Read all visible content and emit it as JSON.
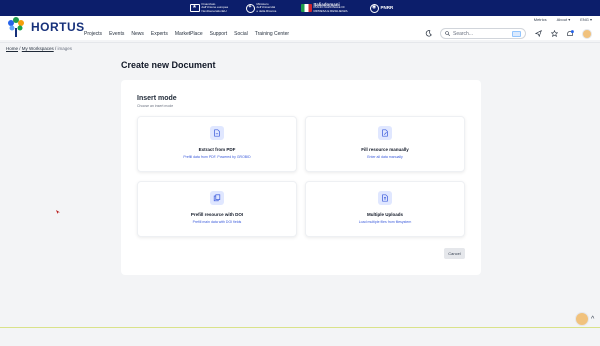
{
  "funding": {
    "eu_line1": "Finanziato",
    "eu_line2": "dall'Unione europea",
    "eu_line3": "NextGenerationEU",
    "ministero_line1": "Ministero",
    "ministero_line2": "dell'Università",
    "ministero_line3": "e della Ricerca",
    "italiadomani": "Italiadomani",
    "italiadomani_sub": "PIANO NAZIONALE DI RIPRESA E RESILIENZA",
    "pnrr": "PNRR"
  },
  "header": {
    "metrics": "Metrics",
    "about": "About ▾",
    "lang": "ENG ▾",
    "brand": "HORTUS",
    "nav": [
      "Projects",
      "Events",
      "News",
      "Experts",
      "MarketPlace",
      "Support",
      "Social",
      "Training Center"
    ],
    "search_placeholder": "Search..."
  },
  "breadcrumb": {
    "home": "Home",
    "workspaces": "My Workspaces",
    "current": "images"
  },
  "page": {
    "title": "Create new Document",
    "section_title": "Insert mode",
    "section_sub": "Choose an insert mode",
    "options": [
      {
        "label": "Extract from PDF",
        "desc": "Prefill data from PDF. Powered by GROBID",
        "icon": "pdf-file-icon"
      },
      {
        "label": "Fill resource manually",
        "desc": "Enter all data manually",
        "icon": "edit-file-icon"
      },
      {
        "label": "Prefill resource with DOI",
        "desc": "Prefill main data with DOI fields",
        "icon": "copy-doc-icon"
      },
      {
        "label": "Multiple Uploads",
        "desc": "Load multiple files from filesystem",
        "icon": "upload-file-icon"
      }
    ],
    "cancel": "Cancel"
  },
  "colors": {
    "accent": "#3b5bdb",
    "funding_bar": "#0c1e6b",
    "brand": "#16307a"
  }
}
